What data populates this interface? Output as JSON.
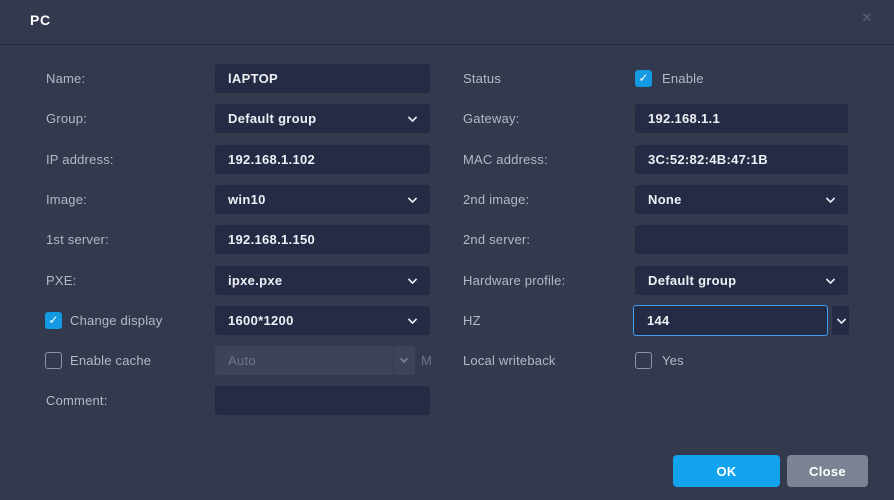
{
  "window": {
    "title": "PC"
  },
  "icons": {
    "close": "✕",
    "check": "✓"
  },
  "left": [
    {
      "label": "Name:",
      "type": "input",
      "value": "lAPTOP"
    },
    {
      "label": "Group:",
      "type": "select",
      "value": "Default group"
    },
    {
      "label": "IP address:",
      "type": "input",
      "value": "192.168.1.102"
    },
    {
      "label": "Image:",
      "type": "select",
      "value": "win10"
    },
    {
      "label": "1st server:",
      "type": "input",
      "value": "192.168.1.150"
    },
    {
      "label": "PXE:",
      "type": "select",
      "value": "ipxe.pxe"
    },
    {
      "label": "Change display",
      "type": "checkbox-select",
      "checked": true,
      "value": "1600*1200"
    },
    {
      "label": "Enable cache",
      "type": "checkbox-disabled-select",
      "checked": false,
      "value": "Auto",
      "suffix": "M"
    },
    {
      "label": "Comment:",
      "type": "input",
      "value": ""
    }
  ],
  "right": [
    {
      "label": "Status",
      "type": "checkbox",
      "checked": true,
      "checkbox_label": "Enable"
    },
    {
      "label": "Gateway:",
      "type": "input",
      "value": "192.168.1.1"
    },
    {
      "label": "MAC address:",
      "type": "input",
      "value": "3C:52:82:4B:47:1B"
    },
    {
      "label": "2nd image:",
      "type": "select",
      "value": "None"
    },
    {
      "label": "2nd server:",
      "type": "input",
      "value": ""
    },
    {
      "label": "Hardware profile:",
      "type": "select",
      "value": "Default group"
    },
    {
      "label": "HZ",
      "type": "combo-focused",
      "value": "144"
    },
    {
      "label": "Local writeback",
      "type": "checkbox",
      "checked": false,
      "checkbox_label": "Yes"
    }
  ],
  "footer": {
    "ok": "OK",
    "close": "Close"
  },
  "colors": {
    "dialog_bg": "#333a4d",
    "field_bg": "#262b45",
    "checkbox_blue": "#149ae3",
    "ok_button_blue": "#12a3ef",
    "close_button_gray": "#7b8394",
    "focus_border_blue": "#3f9ff0"
  }
}
